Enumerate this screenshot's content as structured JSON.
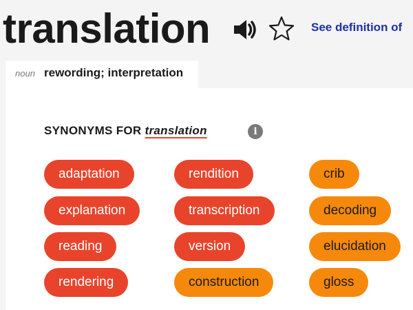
{
  "entry": {
    "word": "translation",
    "see_definition": "See definition of"
  },
  "sense": {
    "pos": "noun",
    "definition": "rewording; interpretation"
  },
  "synonyms": {
    "heading_prefix": "SYNONYMS FOR",
    "term": "translation",
    "info_glyph": "i",
    "colors": {
      "high_relevance": "#e8442c",
      "medium_relevance": "#f6890c"
    },
    "columns": [
      [
        {
          "word": "adaptation",
          "relevance": "high"
        },
        {
          "word": "explanation",
          "relevance": "high"
        },
        {
          "word": "reading",
          "relevance": "high"
        },
        {
          "word": "rendering",
          "relevance": "high"
        }
      ],
      [
        {
          "word": "rendition",
          "relevance": "high"
        },
        {
          "word": "transcription",
          "relevance": "high"
        },
        {
          "word": "version",
          "relevance": "high"
        },
        {
          "word": "construction",
          "relevance": "medium"
        }
      ],
      [
        {
          "word": "crib",
          "relevance": "medium"
        },
        {
          "word": "decoding",
          "relevance": "medium"
        },
        {
          "word": "elucidation",
          "relevance": "medium"
        },
        {
          "word": "gloss",
          "relevance": "medium"
        }
      ]
    ]
  }
}
